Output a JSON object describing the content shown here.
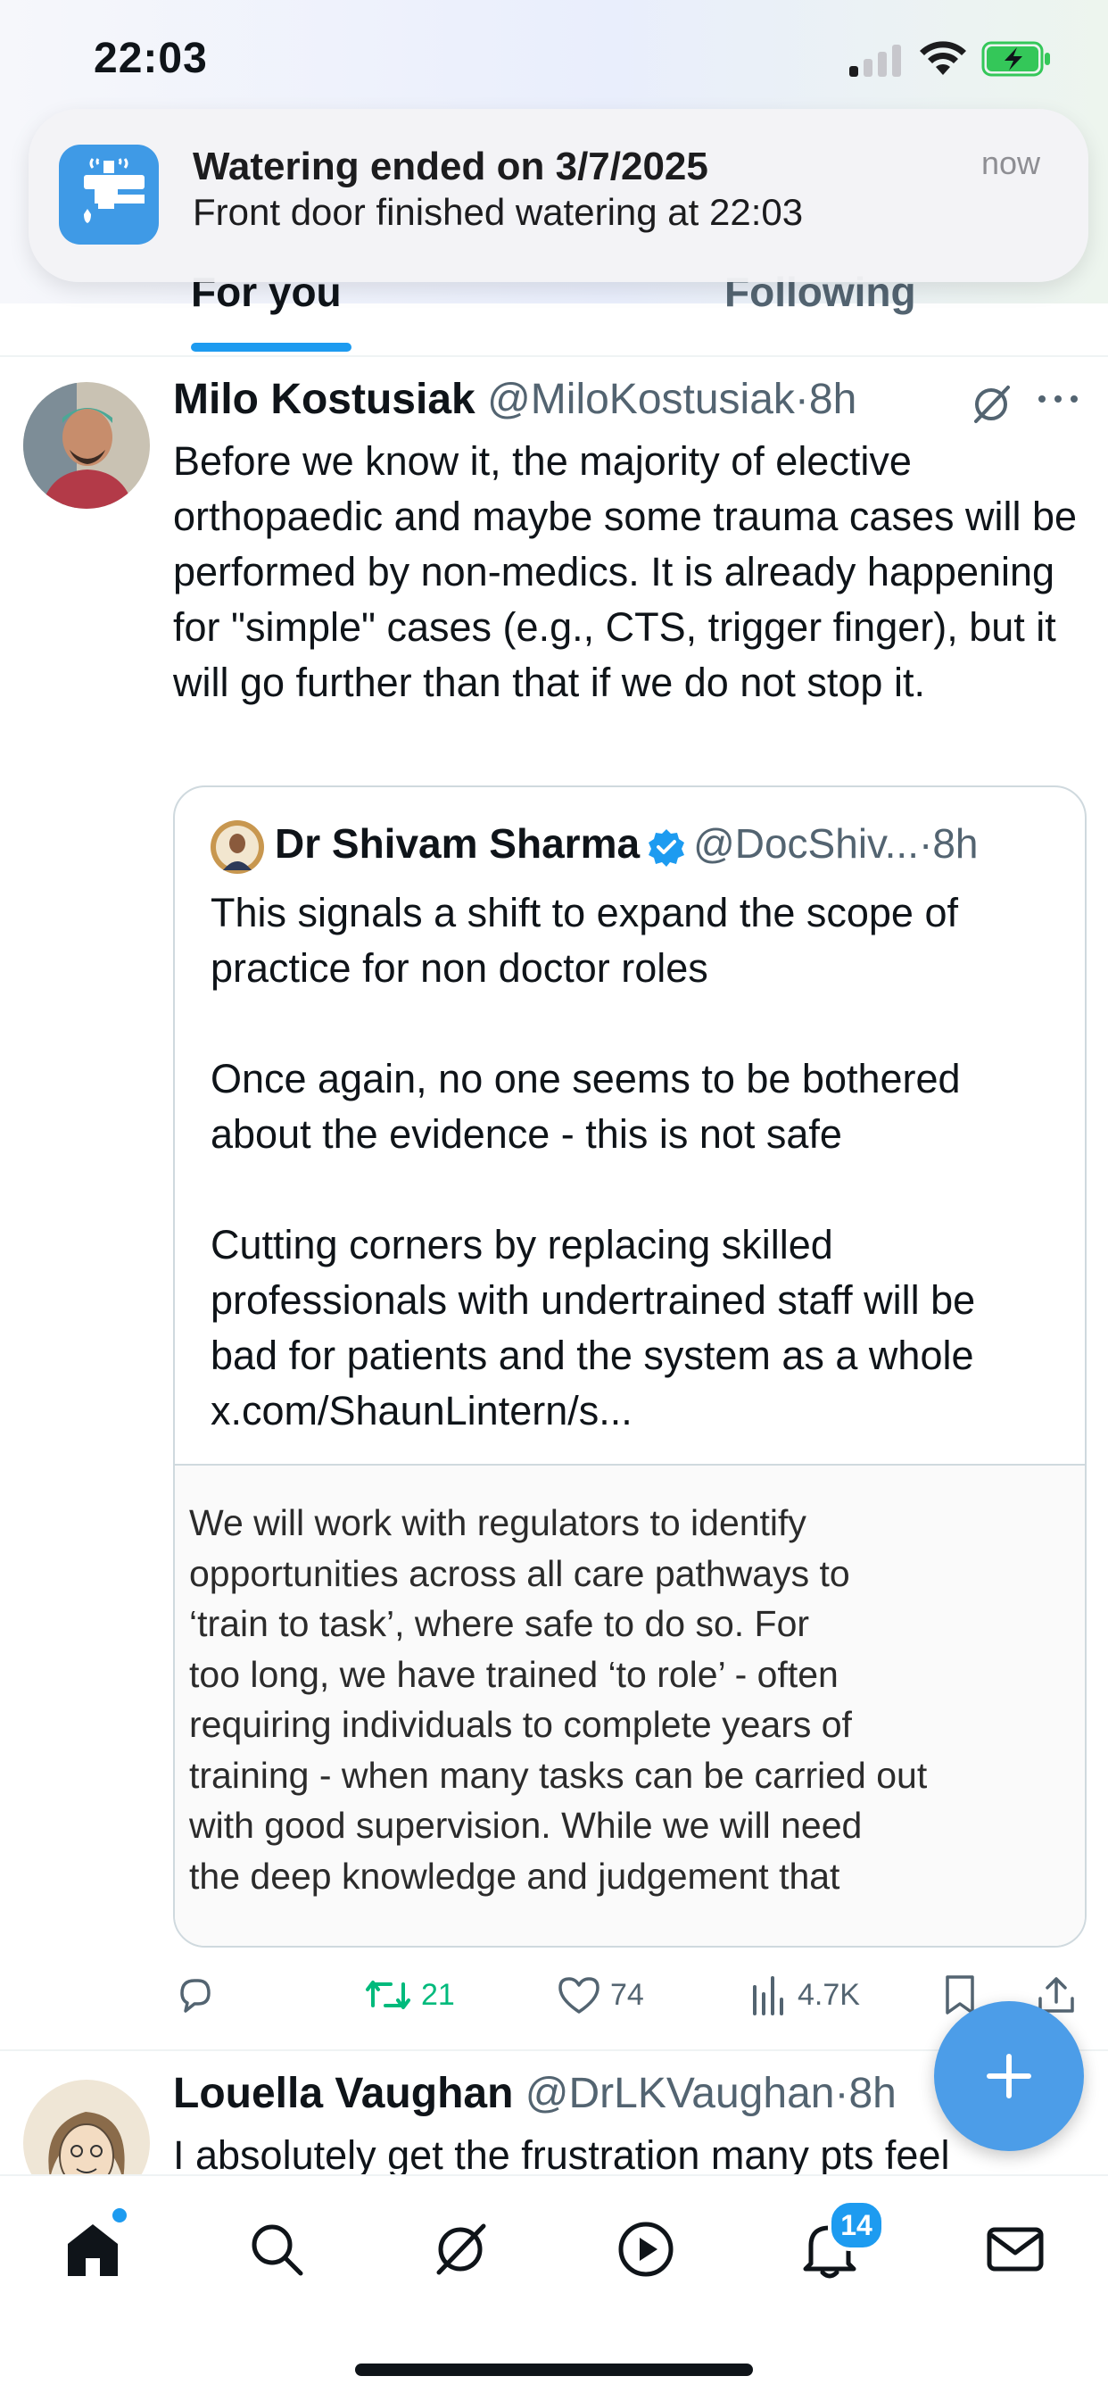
{
  "status_bar": {
    "time": "22:03"
  },
  "notification": {
    "app_icon": "watering-tap-icon",
    "title": "Watering ended on 3/7/2025",
    "body": "Front door finished watering at 22:03",
    "time": "now"
  },
  "tabs": [
    {
      "label": "For you",
      "active": true
    },
    {
      "label": "Following",
      "active": false
    }
  ],
  "posts": [
    {
      "author": "Milo Kostusiak",
      "handle": "@MiloKostusiak",
      "age": "8h",
      "text": "Before we know it, the majority of elective orthopaedic and maybe some trauma cases will be performed by non-medics. It is already happening for \"simple\" cases (e.g., CTS, trigger finger), but it will go further than that if we do not stop it.",
      "quote": {
        "author": "Dr Shivam Sharma",
        "handle": "@DocShiv...",
        "age": "8h",
        "text": "This signals a shift to expand the scope of practice for non doctor roles\n\nOnce again, no one seems to be bothered about the evidence - this is not safe\n\nCutting corners by replacing skilled professionals with undertrained staff will be bad for patients and the system as a whole x.com/ShaunLintern/s...",
        "media_text": "We will work with regulators to identify\nopportunities across all care pathways to\n‘train to task’, where safe to do so. For\ntoo long, we have trained ‘to role’ - often\nrequiring individuals to complete years of\ntraining - when many tasks can be carried out\nwith good supervision. While we will need\nthe deep knowledge and judgement that"
      },
      "stats": {
        "reposts": "21",
        "likes": "74",
        "views": "4.7K"
      }
    },
    {
      "author": "Louella Vaughan",
      "handle": "@DrLKVaughan",
      "age": "8h",
      "text": "I absolutely get the frustration many pts feel"
    }
  ],
  "nav": {
    "notifications_badge": "14"
  },
  "colors": {
    "accent": "#1d9bf0",
    "repost": "#00ba7c",
    "text": "#0f1419",
    "muted": "#536471"
  }
}
